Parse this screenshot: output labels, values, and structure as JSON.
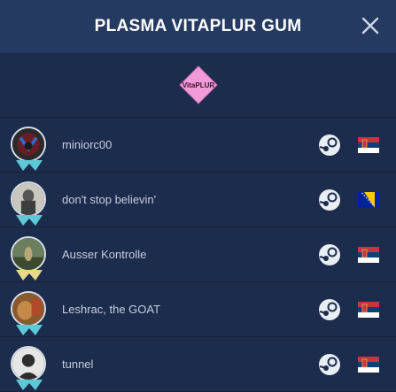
{
  "header": {
    "title": "PLASMA VITAPLUR GUM"
  },
  "team": {
    "logo_text": "VitaPLUR"
  },
  "players": [
    {
      "name": "miniorc00",
      "flag": "serbia"
    },
    {
      "name": "don't stop believin'",
      "flag": "bosnia"
    },
    {
      "name": "Ausser Kontrolle",
      "flag": "serbia"
    },
    {
      "name": "Leshrac, the GOAT",
      "flag": "serbia"
    },
    {
      "name": "tunnel",
      "flag": "serbia"
    }
  ],
  "colors": {
    "header_bg": "#253a60",
    "body_bg": "#1c2c4c",
    "logo_pink": "#f29bd8"
  },
  "icons": {
    "close": "close-icon",
    "steam": "steam-icon"
  }
}
